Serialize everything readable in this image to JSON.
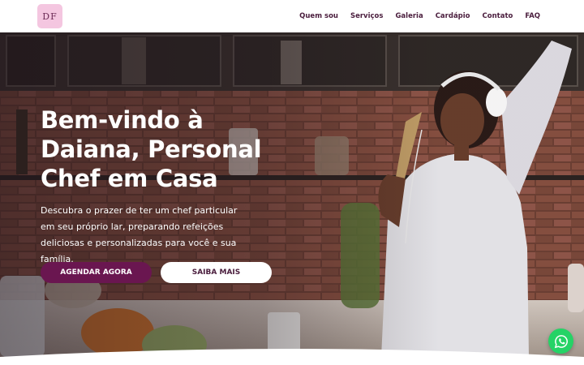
{
  "brand": {
    "logo_text": "DF",
    "icon": "brand-logo-icon",
    "accent": "#6a1650",
    "logo_bg": "#f4c6e0"
  },
  "nav": {
    "items": [
      {
        "label": "Quem sou"
      },
      {
        "label": "Serviços"
      },
      {
        "label": "Galeria"
      },
      {
        "label": "Cardápio"
      },
      {
        "label": "Contato"
      },
      {
        "label": "FAQ"
      }
    ]
  },
  "hero": {
    "title": "Bem-vindo à Daiana, Personal Chef em Casa",
    "subtitle": "Descubra o prazer de ter um chef particular em seu próprio lar, preparando refeições deliciosas e personalizadas para você e sua família.",
    "primary_button": "AGENDAR AGORA",
    "secondary_button": "SAIBA MAIS"
  },
  "floating": {
    "icon": "whatsapp-icon",
    "color": "#25d366"
  }
}
